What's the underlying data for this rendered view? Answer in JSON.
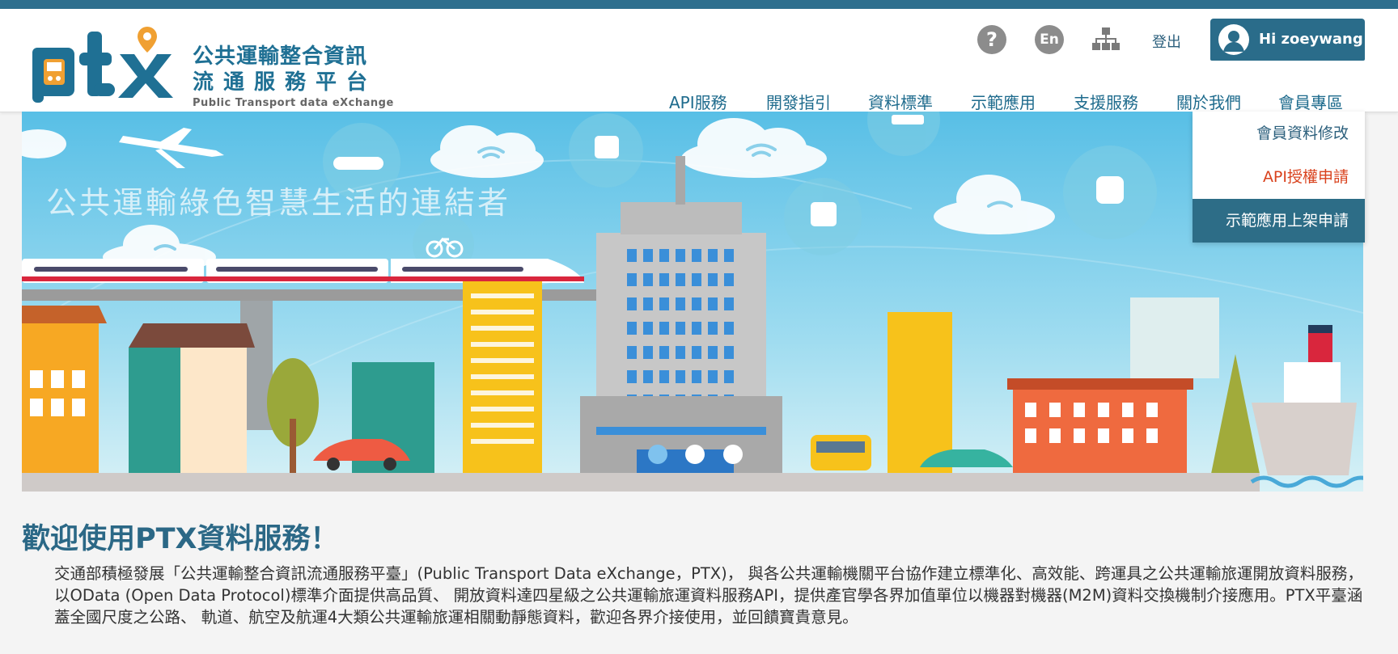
{
  "header": {
    "logo": {
      "mark": "ptx",
      "title_line1": "公共運輸整合資訊",
      "title_line2": "流通服務平台",
      "subtitle": "Public Transport data eXchange"
    },
    "utility": {
      "help_icon": "?",
      "language_label": "En",
      "sitemap_icon": "sitemap-icon",
      "logout_label": "登出",
      "user_greeting": "Hi zoeywang"
    },
    "nav": [
      {
        "label": "API服務"
      },
      {
        "label": "開發指引"
      },
      {
        "label": "資料標準"
      },
      {
        "label": "示範應用"
      },
      {
        "label": "支援服務"
      },
      {
        "label": "關於我們"
      },
      {
        "label": "會員專區"
      }
    ]
  },
  "member_dropdown": {
    "items": [
      {
        "label": "會員資料修改",
        "state": "normal"
      },
      {
        "label": "API授權申請",
        "state": "active"
      },
      {
        "label": "示範應用上架申請",
        "state": "hover"
      }
    ]
  },
  "banner": {
    "caption": "公共運輸綠色智慧生活的連結者",
    "carousel_dot_count": 3,
    "carousel_active_index": 0
  },
  "welcome": {
    "title": "歡迎使用PTX資料服務！",
    "body": "交通部積極發展「公共運輸整合資訊流通服務平臺」(Public Transport Data eXchange，PTX)， 與各公共運輸機關平台協作建立標準化、高效能、跨運具之公共運輸旅運開放資料服務，以OData (Open Data Protocol)標準介面提供高品質、 開放資料達四星級之公共運輸旅運資料服務API，提供產官學各界加值單位以機器對機器(M2M)資料交換機制介接應用。PTX平臺涵蓋全國尺度之公路、 軌道、航空及航運4大類公共運輸旅運相關動靜態資料，歡迎各界介接使用，並回饋寶貴意見。"
  },
  "colors": {
    "brand_blue": "#2a6c8a",
    "nav_text": "#1e6b8d",
    "active_red": "#d9421d",
    "logo_orange": "#f0a032"
  }
}
